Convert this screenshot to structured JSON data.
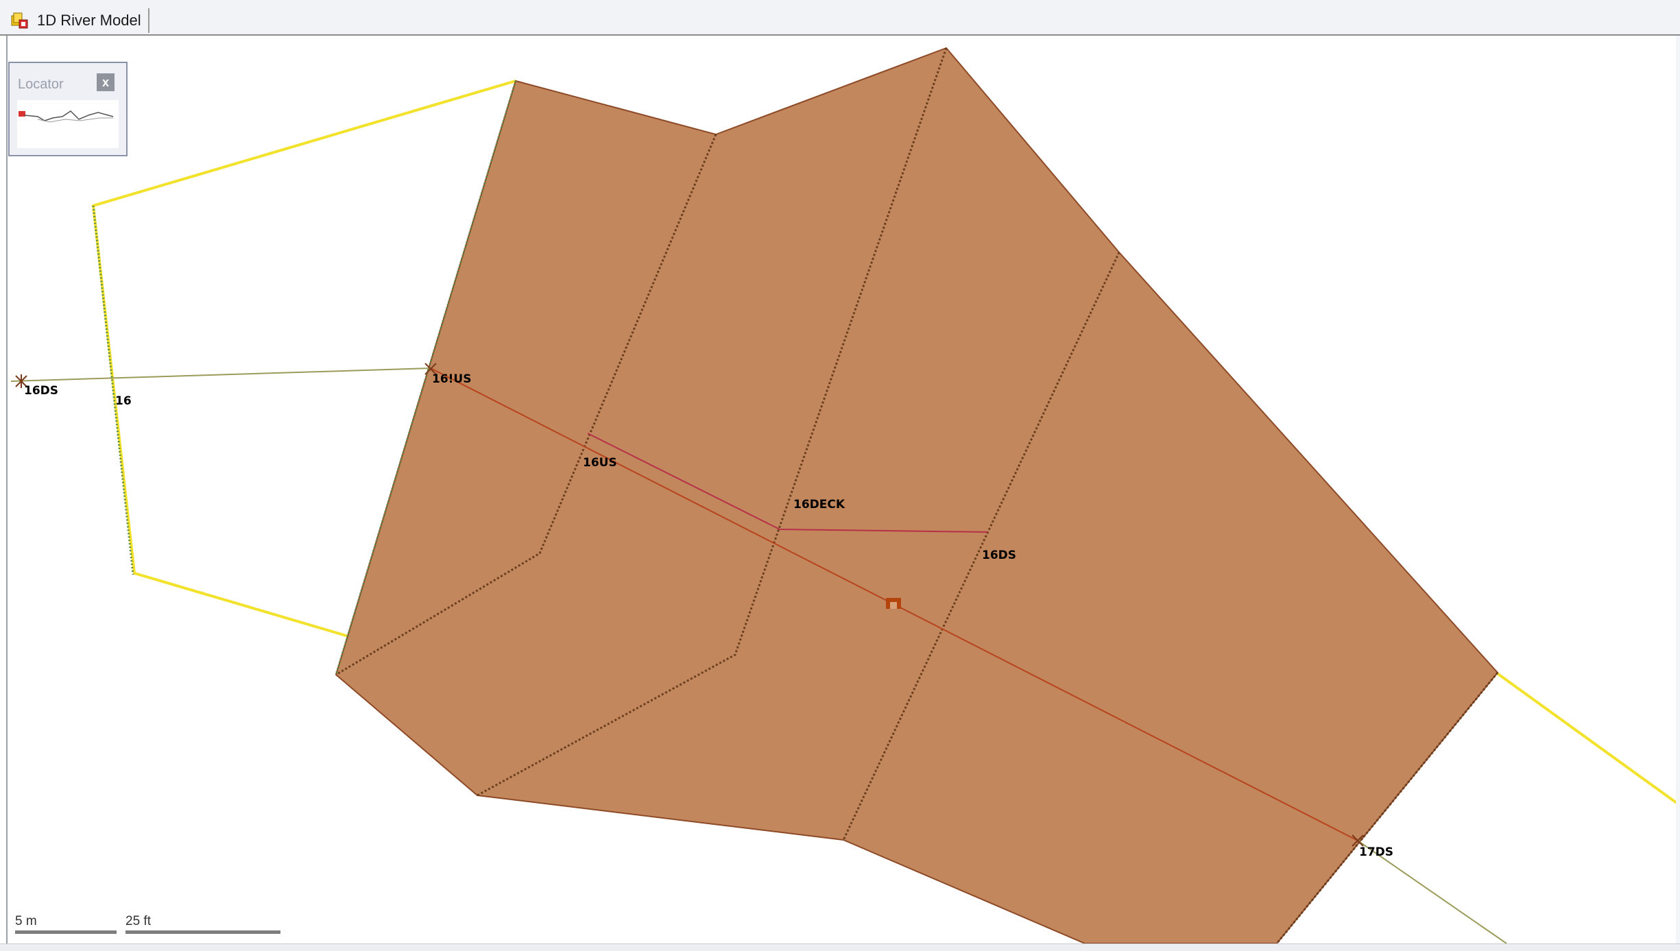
{
  "window": {
    "tab_title": "1D River Model",
    "tab_icon": "river-model-icon"
  },
  "locator": {
    "title": "Locator",
    "close_label": "x"
  },
  "map": {
    "colors": {
      "culvert_fill": "#c2875d",
      "culvert_edge": "#8e4a26",
      "bank_line": "#f3e22c",
      "cross_section_green": "#5e8c4a",
      "cross_section_dotted": "#6b3f1e",
      "flow_line": "#b8441e",
      "deck_line": "#b63048",
      "reach_line": "#9b9b5a"
    },
    "labels": {
      "xs_16ds_left": "16DS",
      "xs_16": "16",
      "xs_16ius": "16!US",
      "xs_16us": "16US",
      "xs_16deck": "16DECK",
      "xs_16ds": "16DS",
      "xs_17ds": "17DS"
    },
    "structure_icon": "bridge-structure-icon",
    "node_icon": "river-node-icon"
  },
  "scale_bar": {
    "metric_label": "5 m",
    "imperial_label": "25 ft"
  }
}
